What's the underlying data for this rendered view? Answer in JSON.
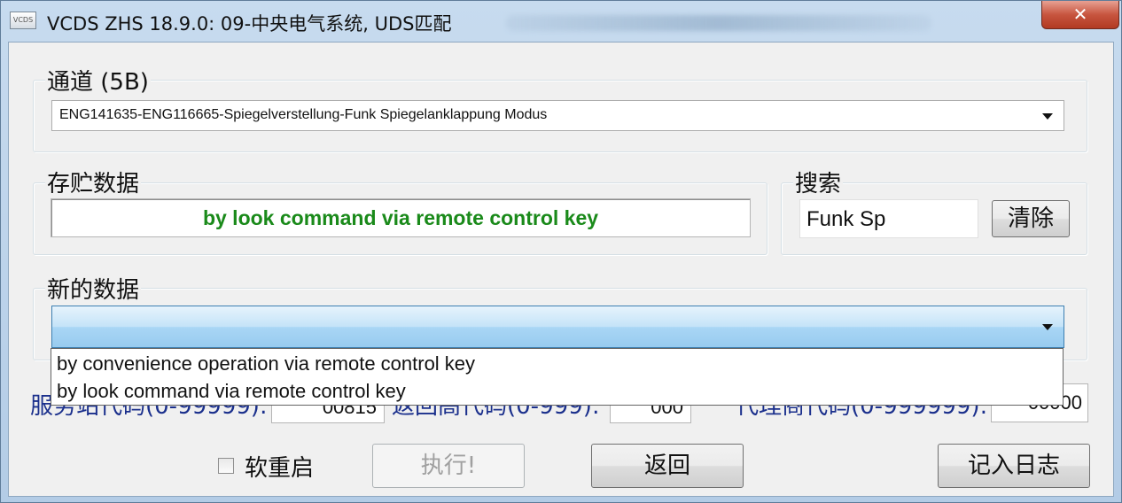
{
  "window": {
    "icon_text": "VCDS",
    "title": "VCDS ZHS 18.9.0: 09-中央电气系统,  UDS匹配",
    "close_glyph": "✕"
  },
  "channel": {
    "label": "通道 (5B)",
    "selected": "ENG141635-ENG116665-Spiegelverstellung-Funk Spiegelanklappung Modus"
  },
  "stored": {
    "label": "存贮数据",
    "value": "by look command via remote control key",
    "value_color": "#1a8a1a"
  },
  "search": {
    "label": "搜索",
    "value": "Funk Sp",
    "clear_label": "清除"
  },
  "new_data": {
    "label": "新的数据",
    "selected": "",
    "options": [
      "by convenience operation via remote control key",
      "by look command via remote control key"
    ]
  },
  "behind": {
    "service_label": "服务站代码(0-99999):",
    "service_value": "00815",
    "return_label": "返回高代码(0-999):",
    "return_value": "000",
    "dealer_label": "代理商代码(0-999999):",
    "dealer_value": "00000"
  },
  "footer": {
    "soft_restart_label": "软重启",
    "soft_restart_checked": false,
    "execute_label": "执行!",
    "back_label": "返回",
    "log_label": "记入日志"
  }
}
